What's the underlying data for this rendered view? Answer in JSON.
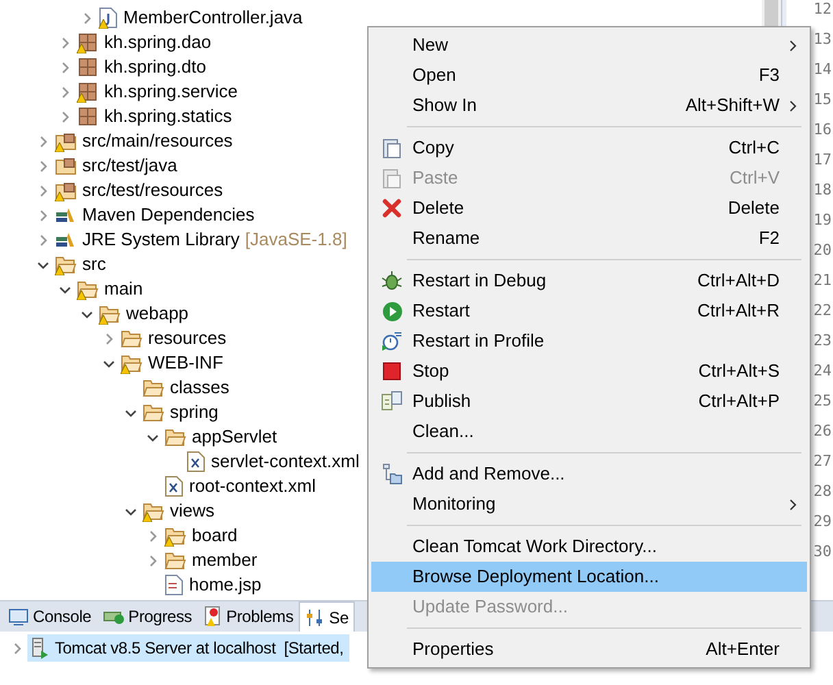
{
  "tree": {
    "items": [
      {
        "children": [
          {
            "children": [
              {
                "label": "MemberController.java",
                "kind": "java",
                "warning": true,
                "expanded": false
              }
            ]
          },
          {
            "label": "kh.spring.dao",
            "kind": "package",
            "warning": true,
            "expanded": false
          },
          {
            "label": "kh.spring.dto",
            "kind": "package",
            "warning": false,
            "expanded": false
          },
          {
            "label": "kh.spring.service",
            "kind": "package",
            "warning": true,
            "expanded": false
          },
          {
            "label": "kh.spring.statics",
            "kind": "package",
            "warning": false,
            "expanded": false
          }
        ]
      },
      {
        "label": "src/main/resources",
        "kind": "source-folder",
        "warning": true,
        "expanded": false
      },
      {
        "label": "src/test/java",
        "kind": "source-folder",
        "warning": false,
        "expanded": false
      },
      {
        "label": "src/test/resources",
        "kind": "source-folder",
        "warning": true,
        "expanded": false
      },
      {
        "label": "Maven Dependencies",
        "kind": "library",
        "warning": false,
        "expanded": false
      },
      {
        "label": "JRE System Library",
        "decoration": "[JavaSE-1.8]",
        "kind": "library",
        "warning": false,
        "expanded": false
      },
      {
        "label": "src",
        "kind": "folder",
        "warning": true,
        "expanded": true,
        "children": [
          {
            "label": "main",
            "kind": "folder",
            "warning": true,
            "expanded": true,
            "children": [
              {
                "label": "webapp",
                "kind": "folder",
                "warning": true,
                "expanded": true,
                "children": [
                  {
                    "label": "resources",
                    "kind": "folder",
                    "warning": false,
                    "expanded": false
                  },
                  {
                    "label": "WEB-INF",
                    "kind": "folder",
                    "warning": true,
                    "expanded": true,
                    "children": [
                      {
                        "label": "classes",
                        "kind": "folder",
                        "warning": false
                      },
                      {
                        "label": "spring",
                        "kind": "folder",
                        "warning": false,
                        "expanded": true,
                        "children": [
                          {
                            "label": "appServlet",
                            "kind": "folder",
                            "warning": false,
                            "expanded": true,
                            "children": [
                              {
                                "label": "servlet-context.xml",
                                "kind": "xml",
                                "warning": false
                              }
                            ]
                          },
                          {
                            "label": "root-context.xml",
                            "kind": "xml",
                            "warning": false
                          }
                        ]
                      },
                      {
                        "label": "views",
                        "kind": "folder",
                        "warning": true,
                        "expanded": true,
                        "children": [
                          {
                            "label": "board",
                            "kind": "folder",
                            "warning": true,
                            "expanded": false
                          },
                          {
                            "label": "member",
                            "kind": "folder",
                            "warning": false,
                            "expanded": false
                          },
                          {
                            "label": "home.jsp",
                            "kind": "jsp",
                            "warning": false
                          }
                        ]
                      }
                    ]
                  }
                ]
              }
            ]
          }
        ]
      }
    ]
  },
  "editor": {
    "line_numbers": [
      "12",
      "13",
      "14",
      "15",
      "16",
      "17",
      "18",
      "19",
      "20",
      "21",
      "22",
      "23",
      "24",
      "25",
      "26",
      "27",
      "28",
      "29",
      "30"
    ]
  },
  "bottom_panel": {
    "tabs": [
      {
        "label": "Console",
        "selected": false
      },
      {
        "label": "Progress",
        "selected": false
      },
      {
        "label": "Problems",
        "selected": false
      },
      {
        "label": "Se",
        "selected": true
      }
    ],
    "servers": [
      {
        "name": "Tomcat v8.5 Server at localhost",
        "status": "[Started,",
        "selected": true
      }
    ]
  },
  "context_menu": {
    "items": [
      {
        "kind": "item",
        "label": "New",
        "submenu": true,
        "disabled": false,
        "selected": false
      },
      {
        "kind": "item",
        "label": "Open",
        "shortcut": "F3",
        "submenu": false,
        "disabled": false,
        "selected": false
      },
      {
        "kind": "item",
        "label": "Show In",
        "shortcut": "Alt+Shift+W",
        "submenu": true,
        "disabled": false,
        "selected": false
      },
      {
        "kind": "separator"
      },
      {
        "kind": "item",
        "label": "Copy",
        "shortcut": "Ctrl+C",
        "submenu": false,
        "disabled": false,
        "selected": false
      },
      {
        "kind": "item",
        "label": "Paste",
        "shortcut": "Ctrl+V",
        "submenu": false,
        "disabled": true,
        "selected": false
      },
      {
        "kind": "item",
        "label": "Delete",
        "shortcut": "Delete",
        "submenu": false,
        "disabled": false,
        "selected": false
      },
      {
        "kind": "item",
        "label": "Rename",
        "shortcut": "F2",
        "submenu": false,
        "disabled": false,
        "selected": false
      },
      {
        "kind": "separator"
      },
      {
        "kind": "item",
        "label": "Restart in Debug",
        "shortcut": "Ctrl+Alt+D",
        "submenu": false,
        "disabled": false,
        "selected": false
      },
      {
        "kind": "item",
        "label": "Restart",
        "shortcut": "Ctrl+Alt+R",
        "submenu": false,
        "disabled": false,
        "selected": false
      },
      {
        "kind": "item",
        "label": "Restart in Profile",
        "submenu": false,
        "disabled": false,
        "selected": false
      },
      {
        "kind": "item",
        "label": "Stop",
        "shortcut": "Ctrl+Alt+S",
        "submenu": false,
        "disabled": false,
        "selected": false
      },
      {
        "kind": "item",
        "label": "Publish",
        "shortcut": "Ctrl+Alt+P",
        "submenu": false,
        "disabled": false,
        "selected": false
      },
      {
        "kind": "item",
        "label": "Clean...",
        "submenu": false,
        "disabled": false,
        "selected": false
      },
      {
        "kind": "separator"
      },
      {
        "kind": "item",
        "label": "Add and Remove...",
        "submenu": false,
        "disabled": false,
        "selected": false
      },
      {
        "kind": "item",
        "label": "Monitoring",
        "submenu": true,
        "disabled": false,
        "selected": false
      },
      {
        "kind": "separator"
      },
      {
        "kind": "item",
        "label": "Clean Tomcat Work Directory...",
        "submenu": false,
        "disabled": false,
        "selected": false
      },
      {
        "kind": "item",
        "label": "Browse Deployment Location...",
        "submenu": false,
        "disabled": false,
        "selected": true
      },
      {
        "kind": "item",
        "label": "Update Password...",
        "submenu": false,
        "disabled": true,
        "selected": false
      },
      {
        "kind": "separator"
      },
      {
        "kind": "item",
        "label": "Properties",
        "shortcut": "Alt+Enter",
        "submenu": false,
        "disabled": false,
        "selected": false
      }
    ]
  }
}
